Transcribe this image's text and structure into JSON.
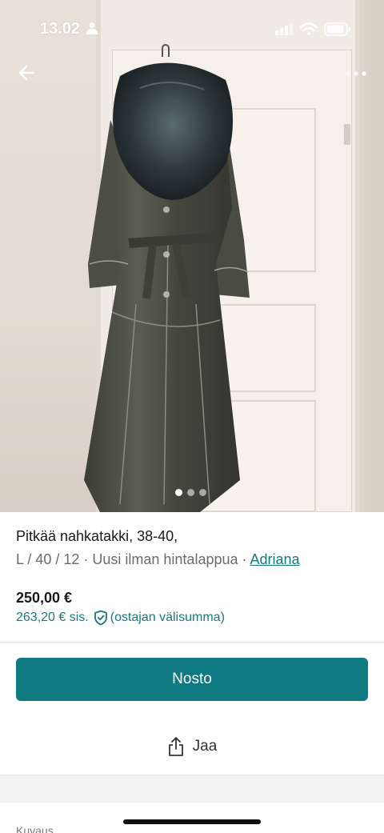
{
  "status_bar": {
    "time": "13.02"
  },
  "product": {
    "title": "Pitkää nahkatakki, 38-40,",
    "details": "L / 40 / 12 · Uusi ilman hintalappua · ",
    "brand": "Adriana",
    "price": "250,00 €",
    "price_incl_prefix": "263,20 € sis.",
    "price_incl_suffix": "(ostajan välisumma)"
  },
  "gallery": {
    "image_count": 3,
    "active_index": 0
  },
  "actions": {
    "buy_label": "Nosto",
    "share_label": "Jaa"
  },
  "below_fold_partial": "Kuvaus",
  "colors": {
    "accent": "#0f7a82",
    "link": "#137a7f"
  }
}
